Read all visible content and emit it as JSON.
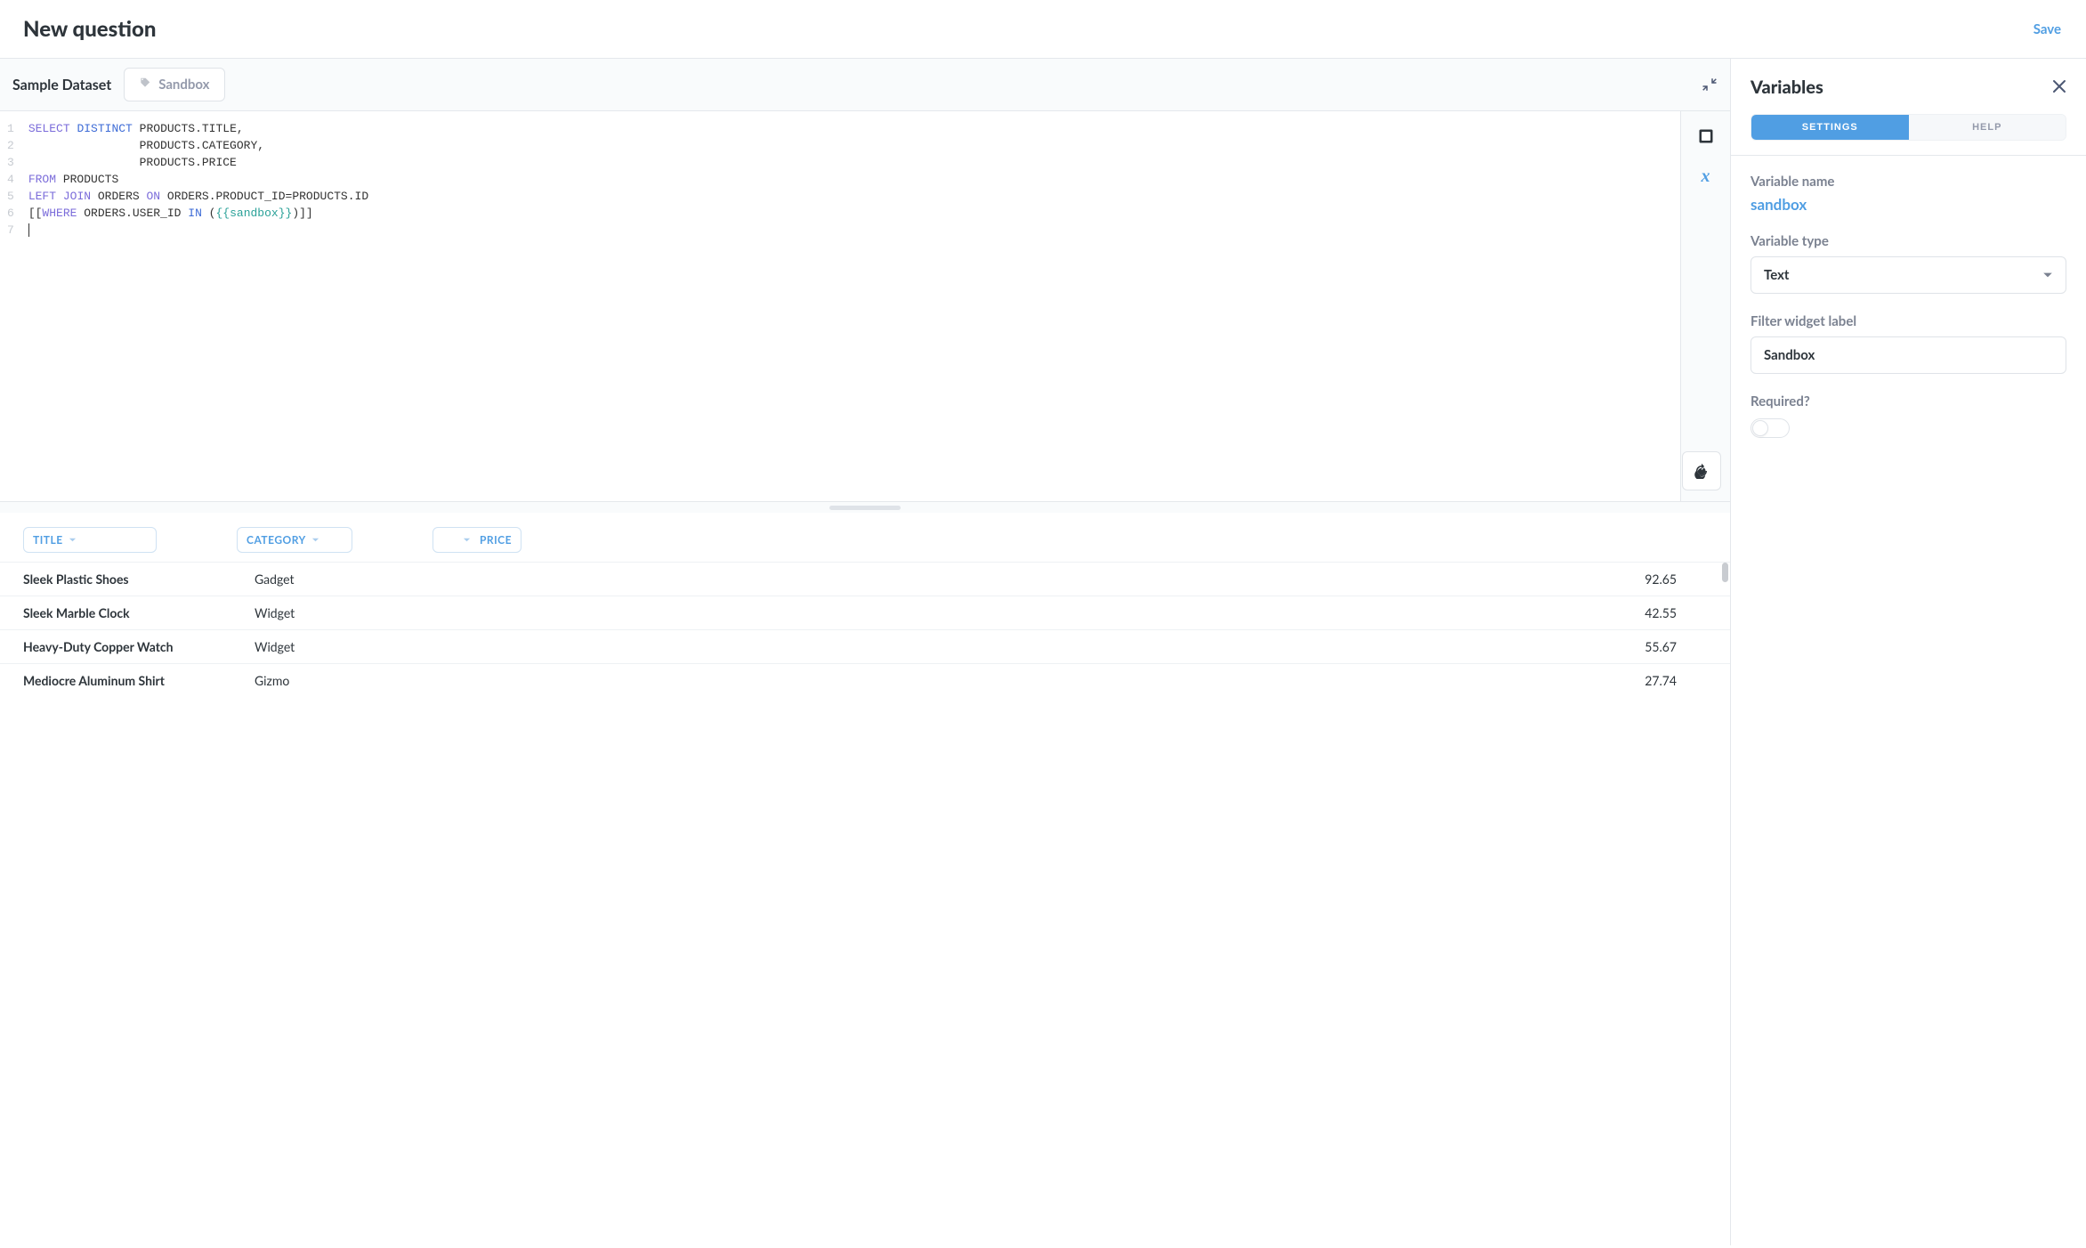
{
  "header": {
    "title": "New question",
    "save_label": "Save"
  },
  "editor": {
    "database_label": "Sample Dataset",
    "filter_pill_label": "Sandbox",
    "line_numbers": [
      "1",
      "2",
      "3",
      "4",
      "5",
      "6",
      "7"
    ],
    "code_tokens": [
      [
        {
          "t": "SELECT",
          "c": "kw"
        },
        {
          "t": " "
        },
        {
          "t": "DISTINCT",
          "c": "kw2"
        },
        {
          "t": " PRODUCTS.TITLE,"
        }
      ],
      [
        {
          "t": "                PRODUCTS.CATEGORY,"
        }
      ],
      [
        {
          "t": "                PRODUCTS.PRICE"
        }
      ],
      [
        {
          "t": "FROM",
          "c": "kw"
        },
        {
          "t": " PRODUCTS"
        }
      ],
      [
        {
          "t": "LEFT",
          "c": "kw"
        },
        {
          "t": " "
        },
        {
          "t": "JOIN",
          "c": "kw"
        },
        {
          "t": " ORDERS "
        },
        {
          "t": "ON",
          "c": "kw"
        },
        {
          "t": " ORDERS.PRODUCT_ID=PRODUCTS.ID"
        }
      ],
      [
        {
          "t": "[["
        },
        {
          "t": "WHERE",
          "c": "kw"
        },
        {
          "t": " ORDERS.USER_ID "
        },
        {
          "t": "IN",
          "c": "kw2"
        },
        {
          "t": " ("
        },
        {
          "t": "{{sandbox}}",
          "c": "var-token"
        },
        {
          "t": ")]]"
        }
      ],
      [
        {
          "t": "",
          "cursor": true
        }
      ]
    ]
  },
  "results": {
    "columns": [
      "TITLE",
      "CATEGORY",
      "PRICE"
    ],
    "rows": [
      {
        "title": "Sleek Plastic Shoes",
        "category": "Gadget",
        "price": "92.65"
      },
      {
        "title": "Sleek Marble Clock",
        "category": "Widget",
        "price": "42.55"
      },
      {
        "title": "Heavy-Duty Copper Watch",
        "category": "Widget",
        "price": "55.67"
      },
      {
        "title": "Mediocre Aluminum Shirt",
        "category": "Gizmo",
        "price": "27.74"
      }
    ]
  },
  "panel": {
    "title": "Variables",
    "tabs": {
      "settings": "SETTINGS",
      "help": "HELP"
    },
    "variable_name_label": "Variable name",
    "variable_name_value": "sandbox",
    "variable_type_label": "Variable type",
    "variable_type_value": "Text",
    "filter_widget_label_label": "Filter widget label",
    "filter_widget_label_value": "Sandbox",
    "required_label": "Required?"
  }
}
